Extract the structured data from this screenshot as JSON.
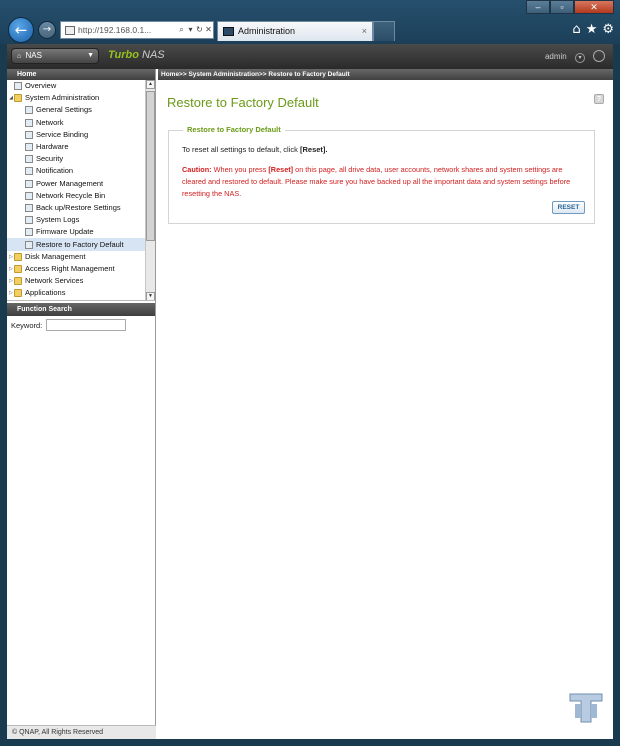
{
  "browser": {
    "url": "http://192.168.0.1...",
    "tab_title": "Administration",
    "tab_close": "×",
    "back_glyph": "←",
    "forward_glyph": "→",
    "icons": [
      "home-icon",
      "favorites-star-icon",
      "settings-gear-icon"
    ]
  },
  "header": {
    "nas_button": "NAS",
    "brand_turbo": "Turbo",
    "brand_nas": "NAS",
    "user": "admin"
  },
  "sidebar": {
    "home_label": "Home",
    "items": [
      {
        "label": "Overview",
        "level": 0,
        "folder": false,
        "toggle": ""
      },
      {
        "label": "System Administration",
        "level": 0,
        "folder": true,
        "toggle": "◢"
      },
      {
        "label": "General Settings",
        "level": 1,
        "folder": false,
        "toggle": ""
      },
      {
        "label": "Network",
        "level": 1,
        "folder": false,
        "toggle": ""
      },
      {
        "label": "Service Binding",
        "level": 1,
        "folder": false,
        "toggle": ""
      },
      {
        "label": "Hardware",
        "level": 1,
        "folder": false,
        "toggle": ""
      },
      {
        "label": "Security",
        "level": 1,
        "folder": false,
        "toggle": ""
      },
      {
        "label": "Notification",
        "level": 1,
        "folder": false,
        "toggle": ""
      },
      {
        "label": "Power Management",
        "level": 1,
        "folder": false,
        "toggle": ""
      },
      {
        "label": "Network Recycle Bin",
        "level": 1,
        "folder": false,
        "toggle": ""
      },
      {
        "label": "Back up/Restore Settings",
        "level": 1,
        "folder": false,
        "toggle": ""
      },
      {
        "label": "System Logs",
        "level": 1,
        "folder": false,
        "toggle": ""
      },
      {
        "label": "Firmware Update",
        "level": 1,
        "folder": false,
        "toggle": ""
      },
      {
        "label": "Restore to Factory Default",
        "level": 1,
        "folder": false,
        "toggle": "",
        "selected": true
      },
      {
        "label": "Disk Management",
        "level": 0,
        "folder": true,
        "toggle": "▷"
      },
      {
        "label": "Access Right Management",
        "level": 0,
        "folder": true,
        "toggle": "▷"
      },
      {
        "label": "Network Services",
        "level": 0,
        "folder": true,
        "toggle": "▷"
      },
      {
        "label": "Applications",
        "level": 0,
        "folder": true,
        "toggle": "▷"
      }
    ],
    "function_search_label": "Function Search",
    "keyword_label": "Keyword:",
    "keyword_value": "",
    "copyright": "© QNAP, All Rights Reserved"
  },
  "main": {
    "breadcrumb": "Home>> System Administration>> Restore to Factory Default",
    "title": "Restore to Factory Default",
    "help_label": "?",
    "section_legend": "Restore to Factory Default",
    "instruction_text": "To reset all settings to default, click ",
    "instruction_bold": "[Reset].",
    "caution_label": "Caution:",
    "caution_pre": " When you press ",
    "caution_reset": "[Reset]",
    "caution_post": " on this page, all drive data, user accounts, network shares and system settings are cleared and restored to default. Please make sure you have backed up all the important data and system settings before resetting the NAS.",
    "reset_button": "RESET"
  },
  "colors": {
    "accent_green": "#6a9a18",
    "caution_red": "#d12020",
    "chrome_blue": "#26506e"
  }
}
